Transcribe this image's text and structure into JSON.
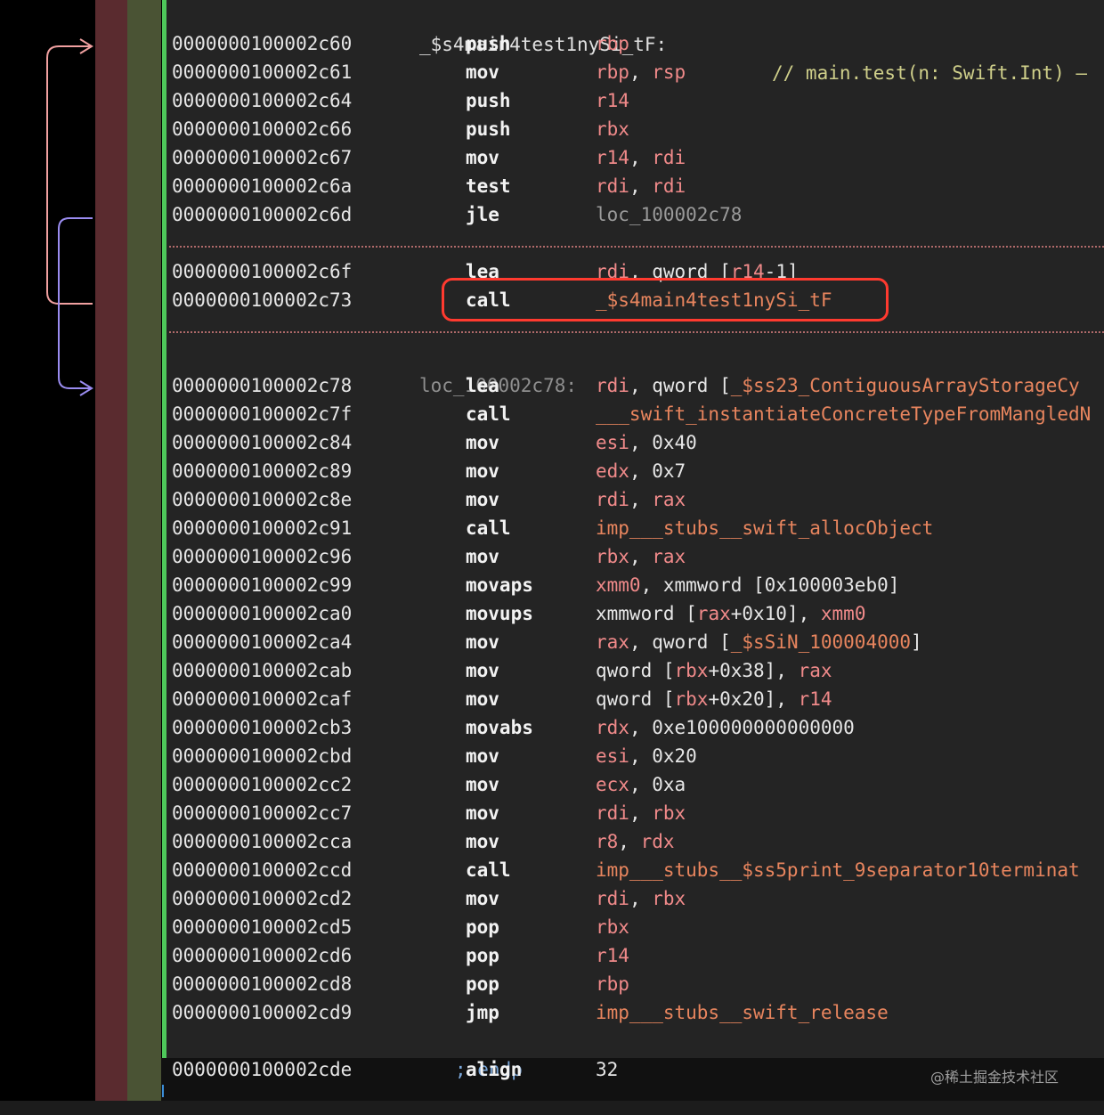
{
  "function_label": "_$s4main4test1nySi_tF:",
  "function_comment": "// main.test(n: Swift.Int) –",
  "block1": [
    {
      "addr": "0000000100002c60",
      "mn": "push",
      "ops": [
        {
          "t": "rbp",
          "c": "reg"
        }
      ]
    },
    {
      "addr": "0000000100002c61",
      "mn": "mov",
      "ops": [
        {
          "t": "rbp",
          "c": "reg"
        },
        {
          "t": ", ",
          "c": "num"
        },
        {
          "t": "rsp",
          "c": "reg"
        }
      ]
    },
    {
      "addr": "0000000100002c64",
      "mn": "push",
      "ops": [
        {
          "t": "r14",
          "c": "reg"
        }
      ]
    },
    {
      "addr": "0000000100002c66",
      "mn": "push",
      "ops": [
        {
          "t": "rbx",
          "c": "reg"
        }
      ]
    },
    {
      "addr": "0000000100002c67",
      "mn": "mov",
      "ops": [
        {
          "t": "r14",
          "c": "reg"
        },
        {
          "t": ", ",
          "c": "num"
        },
        {
          "t": "rdi",
          "c": "reg"
        }
      ]
    },
    {
      "addr": "0000000100002c6a",
      "mn": "test",
      "ops": [
        {
          "t": "rdi",
          "c": "reg"
        },
        {
          "t": ", ",
          "c": "num"
        },
        {
          "t": "rdi",
          "c": "reg"
        }
      ]
    },
    {
      "addr": "0000000100002c6d",
      "mn": "jle",
      "ops": [
        {
          "t": "loc_100002c78",
          "c": "mute"
        }
      ]
    }
  ],
  "block2": [
    {
      "addr": "0000000100002c6f",
      "mn": "lea",
      "ops": [
        {
          "t": "rdi",
          "c": "reg"
        },
        {
          "t": ", qword [",
          "c": "num"
        },
        {
          "t": "r14",
          "c": "reg"
        },
        {
          "t": "-1]",
          "c": "num"
        }
      ]
    },
    {
      "addr": "0000000100002c73",
      "mn": "call",
      "ops": [
        {
          "t": "_$s4main4test1nySi_tF",
          "c": "sym"
        }
      ]
    }
  ],
  "loc_label": "loc_100002c78:",
  "block3": [
    {
      "addr": "0000000100002c78",
      "mn": "lea",
      "ops": [
        {
          "t": "rdi",
          "c": "reg"
        },
        {
          "t": ", qword [",
          "c": "num"
        },
        {
          "t": "_$ss23_ContiguousArrayStorageCy",
          "c": "sym"
        }
      ]
    },
    {
      "addr": "0000000100002c7f",
      "mn": "call",
      "ops": [
        {
          "t": "___swift_instantiateConcreteTypeFromMangledN",
          "c": "sym"
        }
      ]
    },
    {
      "addr": "0000000100002c84",
      "mn": "mov",
      "ops": [
        {
          "t": "esi",
          "c": "reg"
        },
        {
          "t": ", 0x40",
          "c": "num"
        }
      ]
    },
    {
      "addr": "0000000100002c89",
      "mn": "mov",
      "ops": [
        {
          "t": "edx",
          "c": "reg"
        },
        {
          "t": ", 0x7",
          "c": "num"
        }
      ]
    },
    {
      "addr": "0000000100002c8e",
      "mn": "mov",
      "ops": [
        {
          "t": "rdi",
          "c": "reg"
        },
        {
          "t": ", ",
          "c": "num"
        },
        {
          "t": "rax",
          "c": "reg"
        }
      ]
    },
    {
      "addr": "0000000100002c91",
      "mn": "call",
      "ops": [
        {
          "t": "imp___stubs__swift_allocObject",
          "c": "sym"
        }
      ]
    },
    {
      "addr": "0000000100002c96",
      "mn": "mov",
      "ops": [
        {
          "t": "rbx",
          "c": "reg"
        },
        {
          "t": ", ",
          "c": "num"
        },
        {
          "t": "rax",
          "c": "reg"
        }
      ]
    },
    {
      "addr": "0000000100002c99",
      "mn": "movaps",
      "ops": [
        {
          "t": "xmm0",
          "c": "reg"
        },
        {
          "t": ", xmmword [0x100003eb0]",
          "c": "num"
        }
      ]
    },
    {
      "addr": "0000000100002ca0",
      "mn": "movups",
      "ops": [
        {
          "t": "xmmword [",
          "c": "num"
        },
        {
          "t": "rax",
          "c": "reg"
        },
        {
          "t": "+0x10], ",
          "c": "num"
        },
        {
          "t": "xmm0",
          "c": "reg"
        }
      ]
    },
    {
      "addr": "0000000100002ca4",
      "mn": "mov",
      "ops": [
        {
          "t": "rax",
          "c": "reg"
        },
        {
          "t": ", qword [",
          "c": "num"
        },
        {
          "t": "_$sSiN_100004000",
          "c": "sym"
        },
        {
          "t": "]",
          "c": "num"
        }
      ]
    },
    {
      "addr": "0000000100002cab",
      "mn": "mov",
      "ops": [
        {
          "t": "qword [",
          "c": "num"
        },
        {
          "t": "rbx",
          "c": "reg"
        },
        {
          "t": "+0x38], ",
          "c": "num"
        },
        {
          "t": "rax",
          "c": "reg"
        }
      ]
    },
    {
      "addr": "0000000100002caf",
      "mn": "mov",
      "ops": [
        {
          "t": "qword [",
          "c": "num"
        },
        {
          "t": "rbx",
          "c": "reg"
        },
        {
          "t": "+0x20], ",
          "c": "num"
        },
        {
          "t": "r14",
          "c": "reg"
        }
      ]
    },
    {
      "addr": "0000000100002cb3",
      "mn": "movabs",
      "ops": [
        {
          "t": "rdx",
          "c": "reg"
        },
        {
          "t": ", 0xe100000000000000",
          "c": "num"
        }
      ]
    },
    {
      "addr": "0000000100002cbd",
      "mn": "mov",
      "ops": [
        {
          "t": "esi",
          "c": "reg"
        },
        {
          "t": ", 0x20",
          "c": "num"
        }
      ]
    },
    {
      "addr": "0000000100002cc2",
      "mn": "mov",
      "ops": [
        {
          "t": "ecx",
          "c": "reg"
        },
        {
          "t": ", 0xa",
          "c": "num"
        }
      ]
    },
    {
      "addr": "0000000100002cc7",
      "mn": "mov",
      "ops": [
        {
          "t": "rdi",
          "c": "reg"
        },
        {
          "t": ", ",
          "c": "num"
        },
        {
          "t": "rbx",
          "c": "reg"
        }
      ]
    },
    {
      "addr": "0000000100002cca",
      "mn": "mov",
      "ops": [
        {
          "t": "r8",
          "c": "reg"
        },
        {
          "t": ", ",
          "c": "num"
        },
        {
          "t": "rdx",
          "c": "reg"
        }
      ]
    },
    {
      "addr": "0000000100002ccd",
      "mn": "call",
      "ops": [
        {
          "t": "imp___stubs__$ss5print_9separator10terminat",
          "c": "sym"
        }
      ]
    },
    {
      "addr": "0000000100002cd2",
      "mn": "mov",
      "ops": [
        {
          "t": "rdi",
          "c": "reg"
        },
        {
          "t": ", ",
          "c": "num"
        },
        {
          "t": "rbx",
          "c": "reg"
        }
      ]
    },
    {
      "addr": "0000000100002cd5",
      "mn": "pop",
      "ops": [
        {
          "t": "rbx",
          "c": "reg"
        }
      ]
    },
    {
      "addr": "0000000100002cd6",
      "mn": "pop",
      "ops": [
        {
          "t": "r14",
          "c": "reg"
        }
      ]
    },
    {
      "addr": "0000000100002cd8",
      "mn": "pop",
      "ops": [
        {
          "t": "rbp",
          "c": "reg"
        }
      ]
    },
    {
      "addr": "0000000100002cd9",
      "mn": "jmp",
      "ops": [
        {
          "t": "imp___stubs__swift_release",
          "c": "sym"
        }
      ]
    }
  ],
  "endp": "; endp",
  "last_row": {
    "addr": "0000000100002cde",
    "mn": "align",
    "ops": [
      {
        "t": "32",
        "c": "num"
      }
    ]
  },
  "watermark": "@稀土掘金技术社区",
  "colors": {
    "register": "#f08a8a",
    "symbol": "#e8855e",
    "highlight_box": "#ff3a2f",
    "arrow_outer": "#f0a0a0",
    "arrow_inner": "#9a8cf0",
    "gutter_red": "#5a2b2f",
    "gutter_olive": "#4a5334",
    "separator_green": "#4ec85a"
  }
}
